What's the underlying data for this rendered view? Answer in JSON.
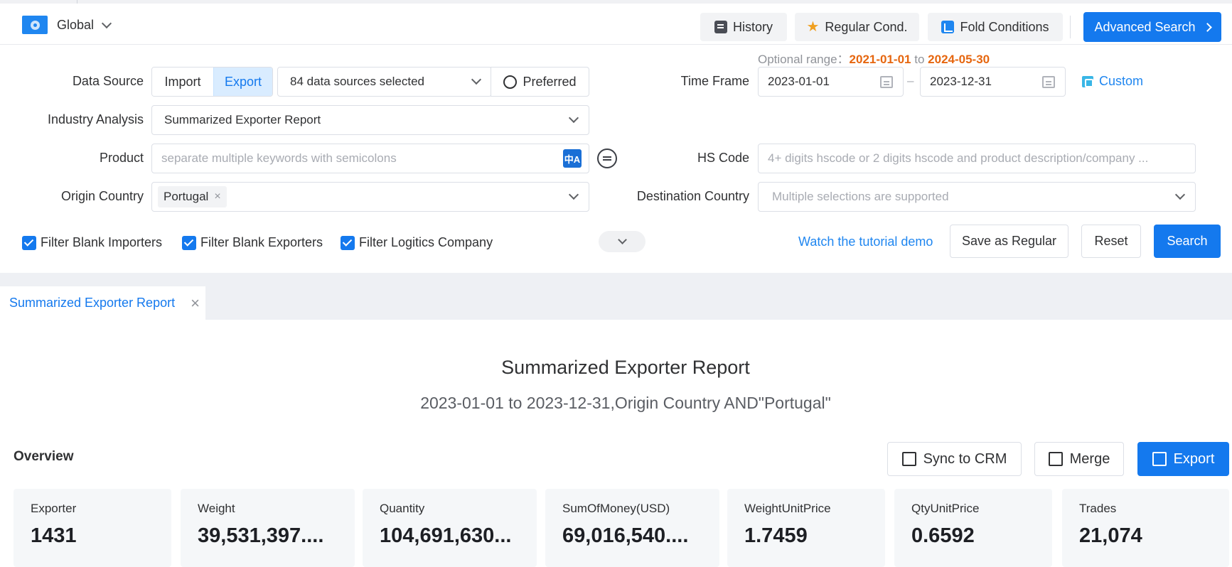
{
  "header": {
    "region_label": "Global",
    "history_label": "History",
    "regular_label": "Regular Cond.",
    "fold_label": "Fold Conditions",
    "advanced_label": "Advanced Search"
  },
  "form": {
    "data_source_label": "Data Source",
    "import_label": "Import",
    "export_label": "Export",
    "sources_selected": "84 data sources selected",
    "preferred_label": "Preferred",
    "optional_range_label": "Optional range：",
    "optional_range_start": "2021-01-01",
    "optional_range_to": "to",
    "optional_range_end": "2024-05-30",
    "time_frame_label": "Time Frame",
    "date_start": "2023-01-01",
    "date_sep": "–",
    "date_end": "2023-12-31",
    "custom_label": "Custom",
    "industry_label": "Industry Analysis",
    "industry_value": "Summarized Exporter Report",
    "product_label": "Product",
    "product_placeholder": "separate multiple keywords with semicolons",
    "translate_icon_text": "中A",
    "hs_label": "HS Code",
    "hs_placeholder": "4+ digits hscode or 2 digits hscode and product description/company ...",
    "origin_label": "Origin Country",
    "origin_tag": "Portugal",
    "tag_close": "×",
    "dest_label": "Destination Country",
    "dest_placeholder": "Multiple selections are supported",
    "filter_importers": "Filter Blank Importers",
    "filter_exporters": "Filter Blank Exporters",
    "filter_logistics": "Filter Logitics Company",
    "tutorial_link": "Watch the tutorial demo",
    "save_regular": "Save as Regular",
    "reset": "Reset",
    "search": "Search"
  },
  "tabs": [
    {
      "label": "Summarized Exporter Report",
      "close": "×"
    }
  ],
  "report": {
    "title": "Summarized Exporter Report",
    "subtitle": "2023-01-01 to 2023-12-31,Origin Country AND\"Portugal\"",
    "overview_label": "Overview",
    "sync_label": "Sync to CRM",
    "merge_label": "Merge",
    "export_label": "Export",
    "cards": [
      {
        "label": "Exporter",
        "value": "1431"
      },
      {
        "label": "Weight",
        "value": "39,531,397...."
      },
      {
        "label": "Quantity",
        "value": "104,691,630..."
      },
      {
        "label": "SumOfMoney(USD)",
        "value": "69,016,540...."
      },
      {
        "label": "WeightUnitPrice",
        "value": "1.7459"
      },
      {
        "label": "QtyUnitPrice",
        "value": "0.6592"
      },
      {
        "label": "Trades",
        "value": "21,074"
      }
    ]
  },
  "colors": {
    "primary": "#1479ee",
    "accent_orange": "#e6660f",
    "star": "#f0a020"
  }
}
